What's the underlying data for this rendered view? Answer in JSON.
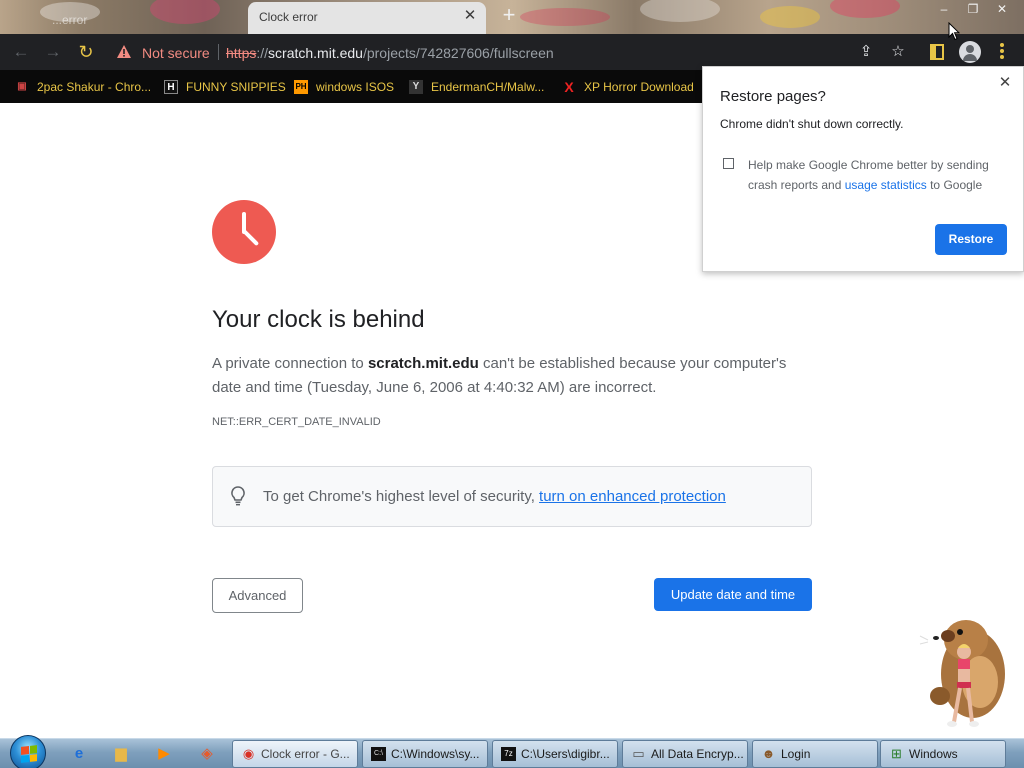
{
  "browser": {
    "active_tab_title": "Clock error",
    "inactive_tab_title": "...error",
    "new_tab_label": "+",
    "window_controls": {
      "minimize": "–",
      "maximize": "❐",
      "close": "✕"
    },
    "security_chip": "Not secure",
    "url": {
      "scheme": "https",
      "separator": "://",
      "host": "scratch.mit.edu",
      "path": "/projects/742827606/fullscreen"
    },
    "toolbar_icons": [
      "back-icon",
      "forward-icon",
      "reload-icon",
      "share-icon",
      "star-icon",
      "sidebar-icon",
      "profile-icon",
      "menu-icon"
    ]
  },
  "bookmarks": [
    {
      "label": "2pac Shakur - Chro...",
      "icon": "2pac-favicon",
      "glyph": "▣",
      "color": "#c44"
    },
    {
      "label": "FUNNY SNIPPIES",
      "icon": "h-favicon",
      "glyph": "H",
      "color": "#fff"
    },
    {
      "label": "windows ISOS",
      "icon": "ph-favicon",
      "glyph": "PH",
      "color": "#f90"
    },
    {
      "label": "EndermanCH/Malw...",
      "icon": "yp-favicon",
      "glyph": "Y",
      "color": "#ddd"
    },
    {
      "label": "XP Horror Download",
      "icon": "x-favicon",
      "glyph": "X",
      "color": "#e22"
    }
  ],
  "error_page": {
    "heading": "Your clock is behind",
    "desc_prefix": "A private connection to ",
    "desc_host": "scratch.mit.edu",
    "desc_suffix": " can't be established because your computer's date and time (Tuesday, June 6, 2006 at 4:40:32 AM) are incorrect.",
    "error_code": "NET::ERR_CERT_DATE_INVALID",
    "tip_text": "To get Chrome's highest level of security, ",
    "tip_link": "turn on enhanced protection",
    "advanced_button": "Advanced",
    "update_button": "Update date and time"
  },
  "restore_popup": {
    "title": "Restore pages?",
    "message": "Chrome didn't shut down correctly.",
    "checkbox_text_prefix": "Help make Google Chrome better by sending crash reports and ",
    "checkbox_link": "usage statistics",
    "checkbox_text_suffix": " to Google",
    "checkbox_checked": false,
    "restore_button": "Restore",
    "close_label": "✕"
  },
  "taskbar": {
    "pinned": [
      {
        "name": "ie-icon",
        "glyph": "e",
        "color": "#1e6fd9"
      },
      {
        "name": "explorer-icon",
        "glyph": "▆",
        "color": "#e8b84a"
      },
      {
        "name": "media-player-icon",
        "glyph": "▶",
        "color": "#ff8a00"
      },
      {
        "name": "app-icon",
        "glyph": "◈",
        "color": "#e65a2c"
      }
    ],
    "tasks": [
      {
        "label": "Clock error - G...",
        "icon": "chrome-icon",
        "glyph": "◉",
        "color": "#d93025"
      },
      {
        "label": "C:\\Windows\\sy...",
        "icon": "cmd-icon",
        "glyph": "C:\\",
        "color": "#111"
      },
      {
        "label": "C:\\Users\\digibr...",
        "icon": "7zip-icon",
        "glyph": "7z",
        "color": "#111"
      },
      {
        "label": "All Data Encryp...",
        "icon": "drive-icon",
        "glyph": "▭",
        "color": "#555"
      },
      {
        "label": "Login",
        "icon": "user-icon",
        "glyph": "☻",
        "color": "#8a5a2b"
      },
      {
        "label": "Windows",
        "icon": "windows-icon",
        "glyph": "⊞",
        "color": "#2a7d2a"
      }
    ]
  },
  "colors": {
    "accent": "#1a73e8",
    "clock_red": "#ee5a52",
    "warning": "#f28b82",
    "bookmark_text": "#e8c547"
  }
}
